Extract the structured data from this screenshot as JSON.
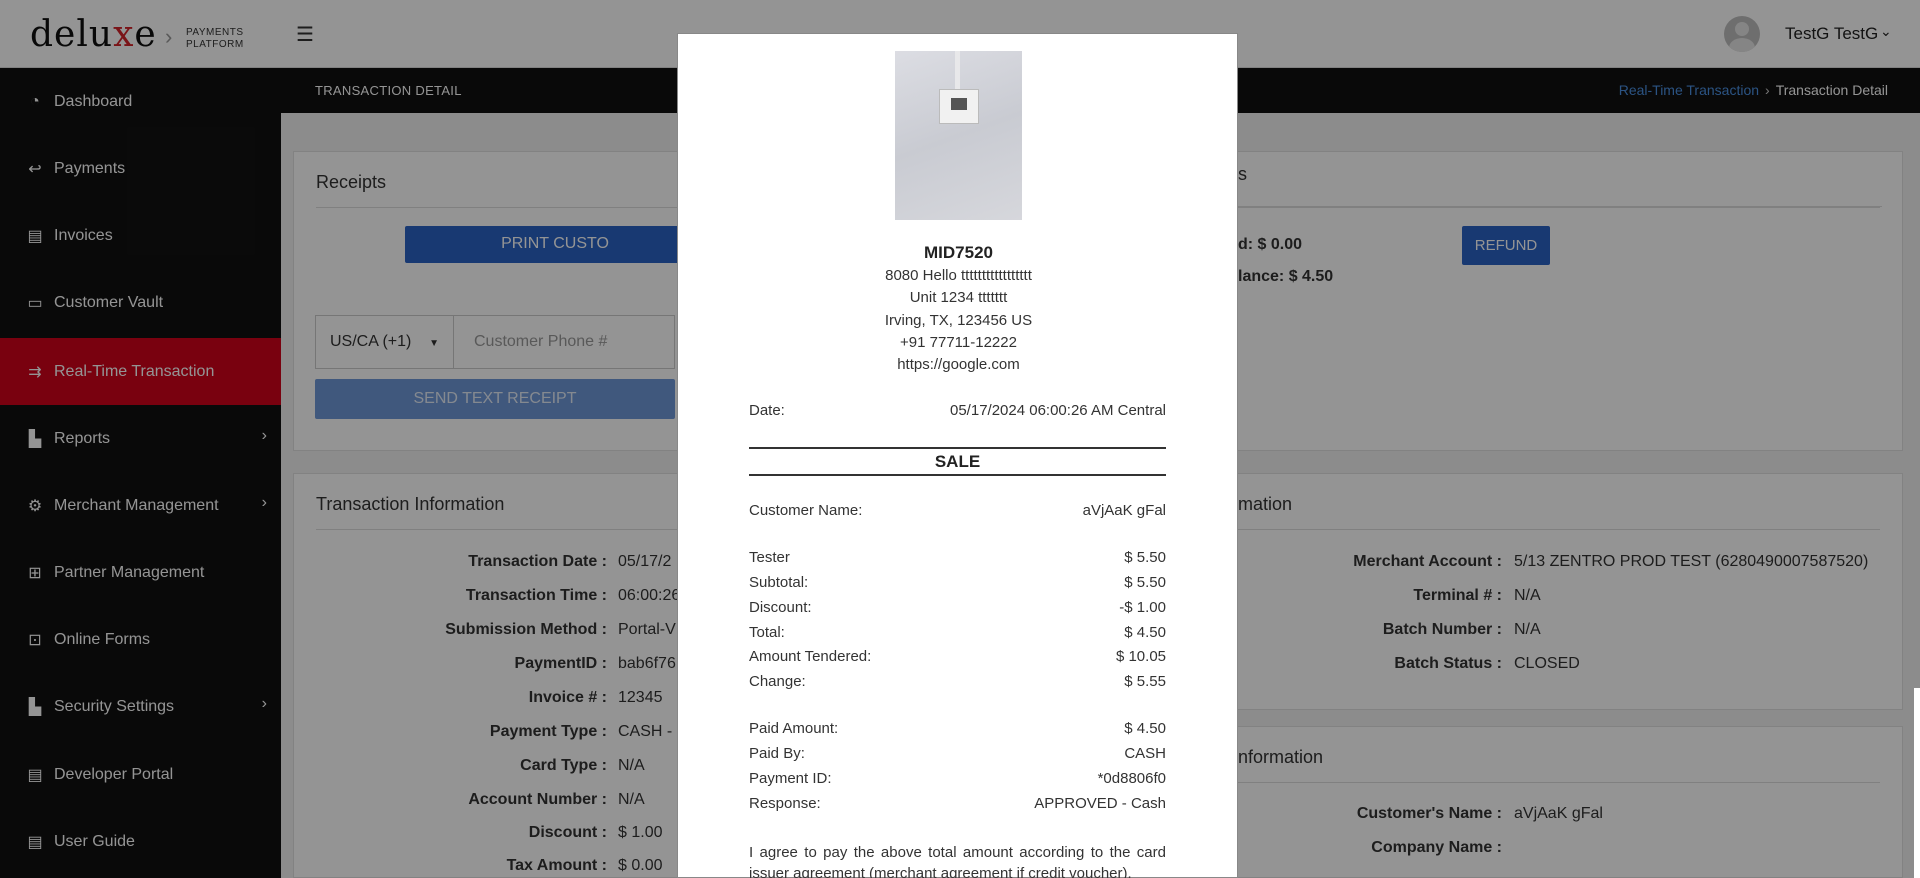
{
  "header": {
    "logo_main": "delu",
    "logo_x": "x",
    "logo_e": "e",
    "logo_sub_line1": "PAYMENTS",
    "logo_sub_line2": "PLATFORM",
    "user_name": "TestG TestG"
  },
  "sidebar": {
    "items": [
      {
        "label": "Dashboard",
        "icon": "dashboard-icon"
      },
      {
        "label": "Payments",
        "icon": "payments-icon"
      },
      {
        "label": "Invoices",
        "icon": "invoice-icon"
      },
      {
        "label": "Customer Vault",
        "icon": "card-icon"
      },
      {
        "label": "Real-Time Transaction",
        "icon": "realtime-icon",
        "active": true
      },
      {
        "label": "Reports",
        "icon": "bar-chart-icon",
        "has_submenu": true
      },
      {
        "label": "Merchant Management",
        "icon": "user-gear-icon",
        "has_submenu": true
      },
      {
        "label": "Partner Management",
        "icon": "sitemap-icon"
      },
      {
        "label": "Online Forms",
        "icon": "form-icon"
      },
      {
        "label": "Security Settings",
        "icon": "bar-chart-icon",
        "has_submenu": true
      },
      {
        "label": "Developer Portal",
        "icon": "document-icon"
      },
      {
        "label": "User Guide",
        "icon": "document-icon"
      }
    ]
  },
  "page": {
    "label": "TRANSACTION DETAIL",
    "breadcrumb_link": "Real-Time Transaction",
    "breadcrumb_current": "Transaction Detail"
  },
  "receipts_card": {
    "title": "Receipts",
    "print_button": "PRINT CUSTO",
    "phone_country": "US/CA (+1)",
    "phone_placeholder": "Customer Phone #",
    "send_text_button": "SEND TEXT RECEIPT"
  },
  "actions_card": {
    "title_fragment": "s",
    "refunded_fragment": "d: ",
    "refunded_value": "$ 0.00",
    "balance_fragment": "lance: ",
    "balance_value": "$ 4.50",
    "refund_button": "REFUND"
  },
  "transaction_info": {
    "title": "Transaction Information",
    "rows": [
      {
        "label": "Transaction Date :",
        "value": "05/17/2"
      },
      {
        "label": "Transaction Time :",
        "value": "06:00:26"
      },
      {
        "label": "Submission Method :",
        "value": "Portal-V"
      },
      {
        "label": "PaymentID :",
        "value": "bab6f76"
      },
      {
        "label": "Invoice # :",
        "value": "12345"
      },
      {
        "label": "Payment Type :",
        "value": "CASH - S"
      },
      {
        "label": "Card Type :",
        "value": "N/A"
      },
      {
        "label": "Account Number :",
        "value": "N/A"
      },
      {
        "label": "Discount :",
        "value": "$ 1.00"
      },
      {
        "label": "Tax Amount :",
        "value": "$ 0.00"
      }
    ]
  },
  "merchant_info": {
    "title_fragment": "mation",
    "rows": [
      {
        "label": "Merchant Account :",
        "value": "5/13 ZENTRO PROD TEST (6280490007587520)"
      },
      {
        "label": "Terminal # :",
        "value": "N/A"
      },
      {
        "label": "Batch Number :",
        "value": "N/A"
      },
      {
        "label": "Batch Status :",
        "value": "CLOSED"
      }
    ]
  },
  "customer_info": {
    "title_fragment": "nformation",
    "rows": [
      {
        "label": "Customer's Name :",
        "value": "aVjAaK gFal"
      },
      {
        "label": "Company Name :",
        "value": ""
      }
    ]
  },
  "receipt": {
    "merchant_id": "MID7520",
    "address_lines": [
      "8080 Hello ttttttttttttttttt",
      "Unit 1234 ttttttt",
      "Irving, TX, 123456 US",
      "+91 77711-12222",
      "https://google.com"
    ],
    "date_label": "Date:",
    "date_value": "05/17/2024 06:00:26 AM Central",
    "type": "SALE",
    "customer_label": "Customer Name:",
    "customer_value": "aVjAaK gFal",
    "items": [
      {
        "label": "Tester",
        "value": "$ 5.50"
      },
      {
        "label": "Subtotal:",
        "value": "$ 5.50"
      },
      {
        "label": "Discount:",
        "value": "-$ 1.00"
      },
      {
        "label": "Total:",
        "value": "$ 4.50"
      },
      {
        "label": "Amount Tendered:",
        "value": "$ 10.05"
      },
      {
        "label": "Change:",
        "value": "$ 5.55"
      }
    ],
    "payment": [
      {
        "label": "Paid Amount:",
        "value": "$ 4.50"
      },
      {
        "label": "Paid By:",
        "value": "CASH"
      },
      {
        "label": "Payment ID:",
        "value": "*0d8806f0"
      },
      {
        "label": "Response:",
        "value": "APPROVED - Cash"
      }
    ],
    "agreement": "I agree to pay the above total amount according to the card issuer agreement (merchant agreement if credit voucher)."
  },
  "colors": {
    "brand_red": "#d0021b",
    "sidebar_bg": "#111111",
    "primary_blue": "#2a62c4",
    "link_blue": "#4a90e2"
  }
}
